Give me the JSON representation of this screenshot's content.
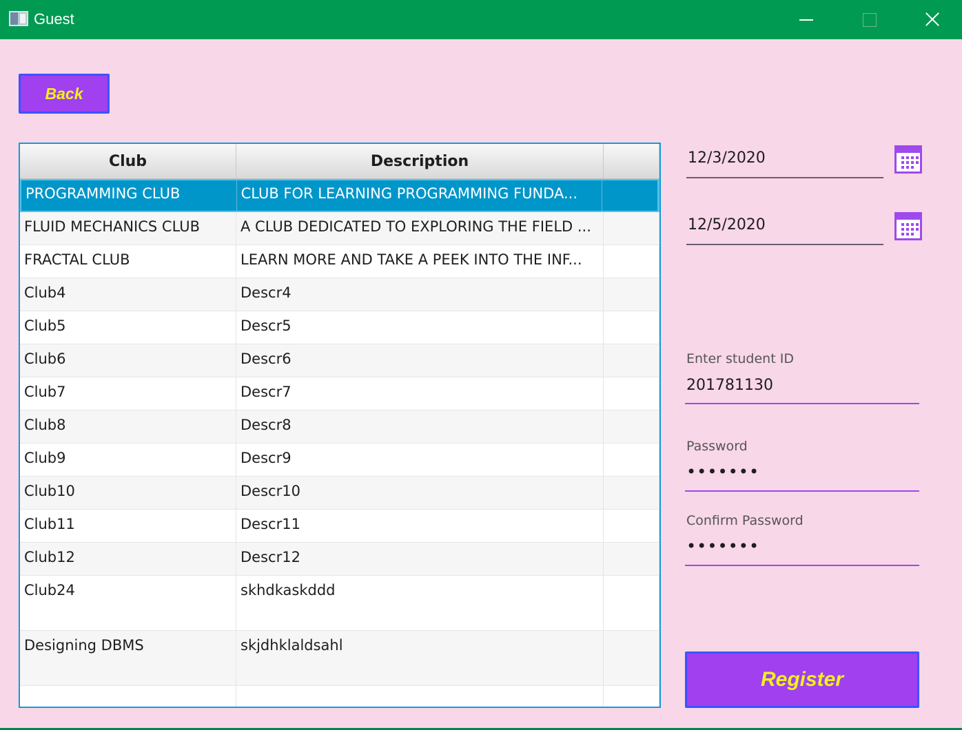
{
  "window": {
    "title": "Guest"
  },
  "back_label": "Back",
  "table": {
    "headers": [
      "Club",
      "Description",
      ""
    ],
    "rows": [
      {
        "club": "PROGRAMMING CLUB",
        "description": "CLUB FOR LEARNING PROGRAMMING FUNDA...",
        "selected": true
      },
      {
        "club": "FLUID MECHANICS CLUB",
        "description": "A CLUB DEDICATED TO EXPLORING THE FIELD ..."
      },
      {
        "club": "FRACTAL CLUB",
        "description": "LEARN MORE AND TAKE A PEEK INTO THE INF..."
      },
      {
        "club": "Club4",
        "description": "Descr4"
      },
      {
        "club": "Club5",
        "description": "Descr5"
      },
      {
        "club": "Club6",
        "description": "Descr6"
      },
      {
        "club": "Club7",
        "description": "Descr7"
      },
      {
        "club": "Club8",
        "description": "Descr8"
      },
      {
        "club": "Club9",
        "description": "Descr9"
      },
      {
        "club": "Club10",
        "description": "Descr10"
      },
      {
        "club": "Club11",
        "description": "Descr11"
      },
      {
        "club": "Club12",
        "description": "Descr12"
      },
      {
        "club": "Club24",
        "description": "skhdkaskddd"
      },
      {
        "club": "Designing DBMS",
        "description": "skjdhklaldsahl"
      }
    ]
  },
  "dates": {
    "start": "12/3/2020",
    "end": "12/5/2020"
  },
  "form": {
    "student_id_label": "Enter student ID",
    "student_id_value": "201781130",
    "password_label": "Password",
    "password_value": "•••••••",
    "confirm_label": "Confirm Password",
    "confirm_value": "•••••••"
  },
  "register_label": "Register",
  "colors": {
    "titlebar": "#009a52",
    "background": "#f8d7e8",
    "button": "#a040ee",
    "button_text": "#f1f11c",
    "selected_row": "#0096ca"
  },
  "icons": [
    "app-window-icon",
    "minimize-icon",
    "maximize-icon",
    "close-icon",
    "calendar-icon"
  ]
}
